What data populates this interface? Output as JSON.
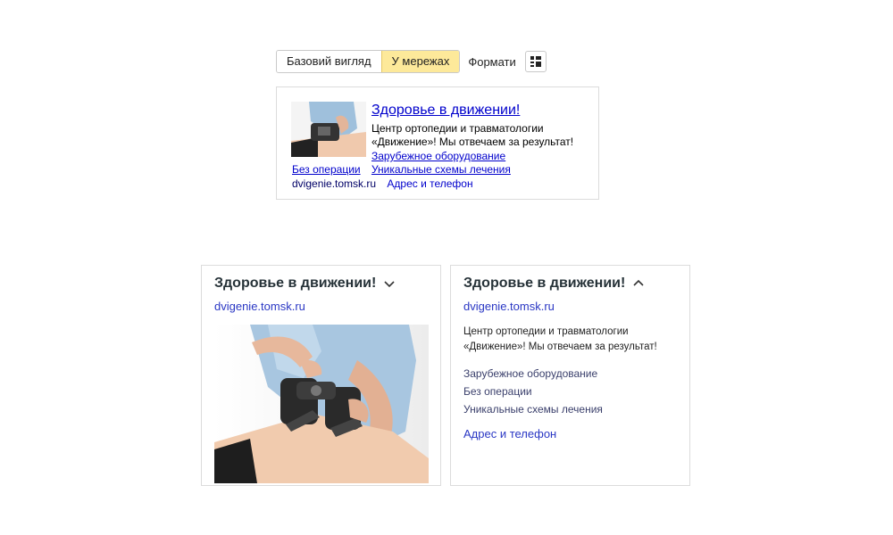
{
  "toolbar": {
    "tabs": [
      {
        "label": "Базовий вигляд",
        "active": false
      },
      {
        "label": "У мережах",
        "active": true
      }
    ],
    "formats_label": "Формати",
    "grid_icon": "grid-layout-icon"
  },
  "small_ad": {
    "title": "Здоровье в движении!",
    "description": "Центр ортопедии и травматологии «Движение»! Мы отвечаем за результат!",
    "sitelinks": [
      "Зарубежное оборудование",
      "Без операции",
      "Уникальные схемы лечения"
    ],
    "domain": "dvigenie.tomsk.ru",
    "contact_link": "Адрес и телефон"
  },
  "card_collapsed": {
    "title": "Здоровье в движении!",
    "toggle_icon": "chevron-down-icon",
    "domain": "dvigenie.tomsk.ru"
  },
  "card_expanded": {
    "title": "Здоровье в движении!",
    "toggle_icon": "chevron-up-icon",
    "domain": "dvigenie.tomsk.ru",
    "description": "Центр ортопедии и травматологии «Движение»! Мы отвечаем за результат!",
    "sitelinks": [
      "Зарубежное оборудование",
      "Без операции",
      "Уникальные схемы лечения"
    ],
    "contact_link": "Адрес и телефон"
  },
  "colors": {
    "active_tab": "#fde99a",
    "link": "#0000cc",
    "card_link": "#2a37c4",
    "card_title": "#263238"
  }
}
